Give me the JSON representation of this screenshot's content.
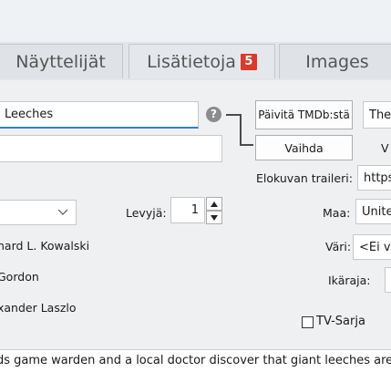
{
  "tabs": [
    {
      "label": "Näyttelijät"
    },
    {
      "label": "Lisätietoja",
      "badge": "5"
    },
    {
      "label": "Images"
    }
  ],
  "fields": {
    "title_value": "Leeches",
    "second_value": ""
  },
  "buttons": {
    "update_tmdb": "Päivitä TMDb:stä",
    "swap": "Vaihda"
  },
  "right_partial": {
    "top_value": "The",
    "v_label": "V"
  },
  "trailer": {
    "label": "Elokuvan traileri:",
    "value": "https"
  },
  "country": {
    "label": "Maa:",
    "value": "Unite"
  },
  "color": {
    "label": "Väri:",
    "value": "<Ei va"
  },
  "age": {
    "label": "Ikäraja:"
  },
  "discs": {
    "label": "Levyjä:",
    "value": "1"
  },
  "tv_series": {
    "label": "TV-Sarja"
  },
  "people": [
    "hard L. Kowalski",
    "Gordon",
    "xander Laszlo"
  ],
  "description": "ds game warden and a local doctor discover that giant leeches are re"
}
